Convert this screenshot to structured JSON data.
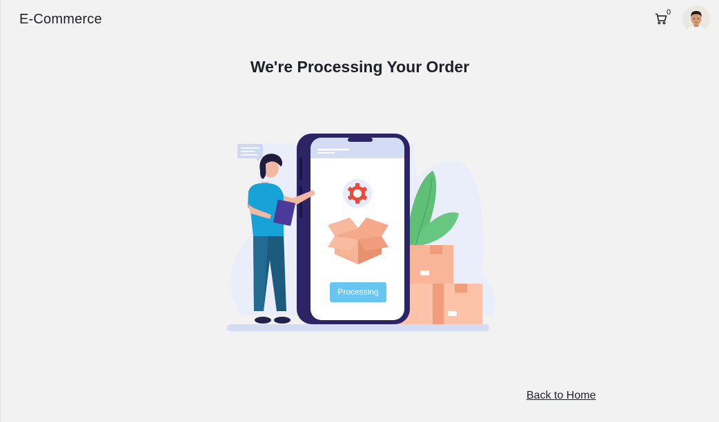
{
  "navbar": {
    "brand": "E-Commerce",
    "cart_count": "0",
    "cart_icon": "cart-icon",
    "avatar_icon": "user-avatar"
  },
  "page": {
    "title": "We're Processing Your Order",
    "illustration_label": "Processing",
    "back_link": "Back to Home"
  },
  "colors": {
    "background": "#f2f2f2",
    "phone_frame": "#2c2465",
    "processing_badge": "#67c6f1",
    "box": "#f4a98a",
    "gear": "#e94b3c",
    "leaf": "#5fbf77"
  }
}
